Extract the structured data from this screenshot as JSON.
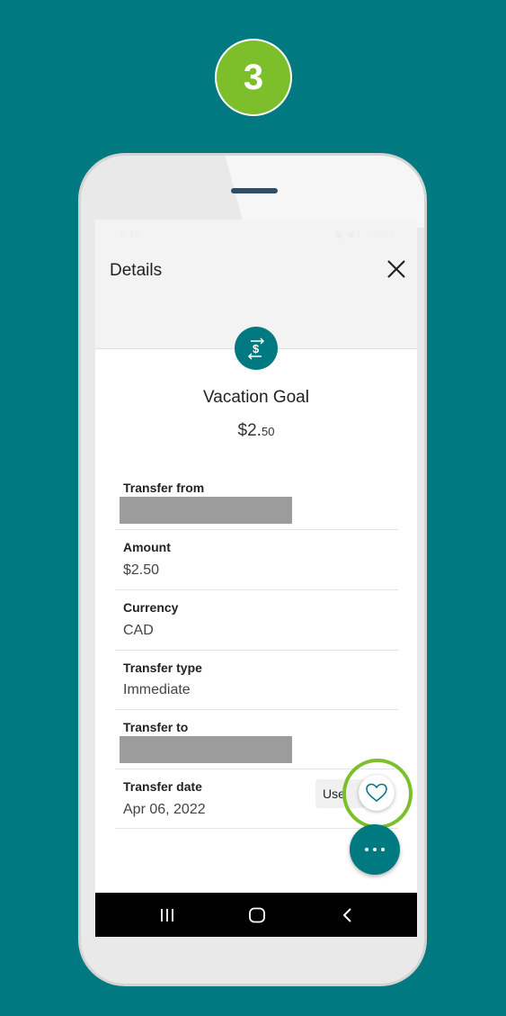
{
  "step": {
    "number": "3"
  },
  "status_bar": {
    "time": "2:13",
    "right": "◉ ◀ ⌇ ⌵ 48%"
  },
  "header": {
    "title": "Details"
  },
  "goal": {
    "title": "Vacation Goal",
    "amount_major": "$2.",
    "amount_minor": "50"
  },
  "details": {
    "transfer_from": {
      "label": "Transfer from"
    },
    "amount": {
      "label": "Amount",
      "value": "$2.50"
    },
    "currency": {
      "label": "Currency",
      "value": "CAD"
    },
    "transfer_type": {
      "label": "Transfer type",
      "value": "Immediate"
    },
    "transfer_to": {
      "label": "Transfer to"
    },
    "transfer_date": {
      "label": "Transfer date",
      "value": "Apr 06, 2022"
    }
  },
  "actions": {
    "use_chip": "Use"
  },
  "colors": {
    "teal": "#017981",
    "highlight_green": "#7cbf2a"
  },
  "icons": [
    "close-icon",
    "transfer-dollar-icon",
    "heart-icon",
    "more-dots-icon",
    "recents-icon",
    "home-icon",
    "back-icon"
  ]
}
